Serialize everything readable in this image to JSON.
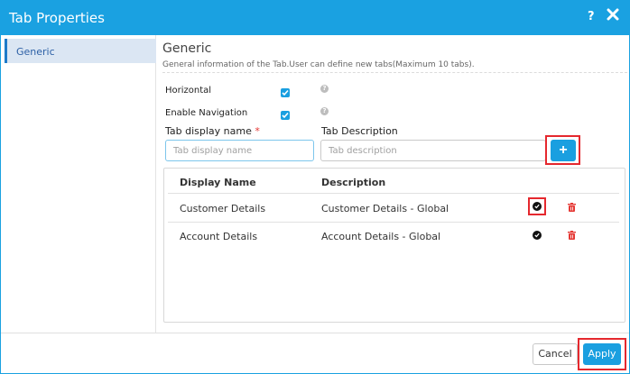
{
  "dialog": {
    "title": "Tab Properties",
    "help_label": "?",
    "close_icon": "close-icon"
  },
  "sidebar": {
    "items": [
      {
        "label": "Generic",
        "selected": true
      }
    ]
  },
  "section": {
    "title": "Generic",
    "description": "General information of the Tab.User can define new tabs(Maximum 10 tabs)."
  },
  "options": {
    "horizontal": {
      "label": "Horizontal",
      "checked": true
    },
    "enable_navigation": {
      "label": "Enable Navigation",
      "checked": true
    },
    "help_glyph": "?"
  },
  "form": {
    "display_name": {
      "label": "Tab display name",
      "required_mark": "*",
      "value": "",
      "placeholder": "Tab display name"
    },
    "description": {
      "label": "Tab Description",
      "value": "",
      "placeholder": "Tab description"
    },
    "add_label": "+"
  },
  "table": {
    "headers": {
      "display_name": "Display Name",
      "description": "Description"
    },
    "rows": [
      {
        "display_name": "Customer Details",
        "description": "Customer Details - Global",
        "default": true
      },
      {
        "display_name": "Account Details",
        "description": "Account Details - Global",
        "default": false
      }
    ]
  },
  "footer": {
    "cancel_label": "Cancel",
    "apply_label": "Apply"
  },
  "colors": {
    "accent": "#1aa1e1",
    "highlight_border": "#e5282e",
    "delete": "#e53935"
  }
}
